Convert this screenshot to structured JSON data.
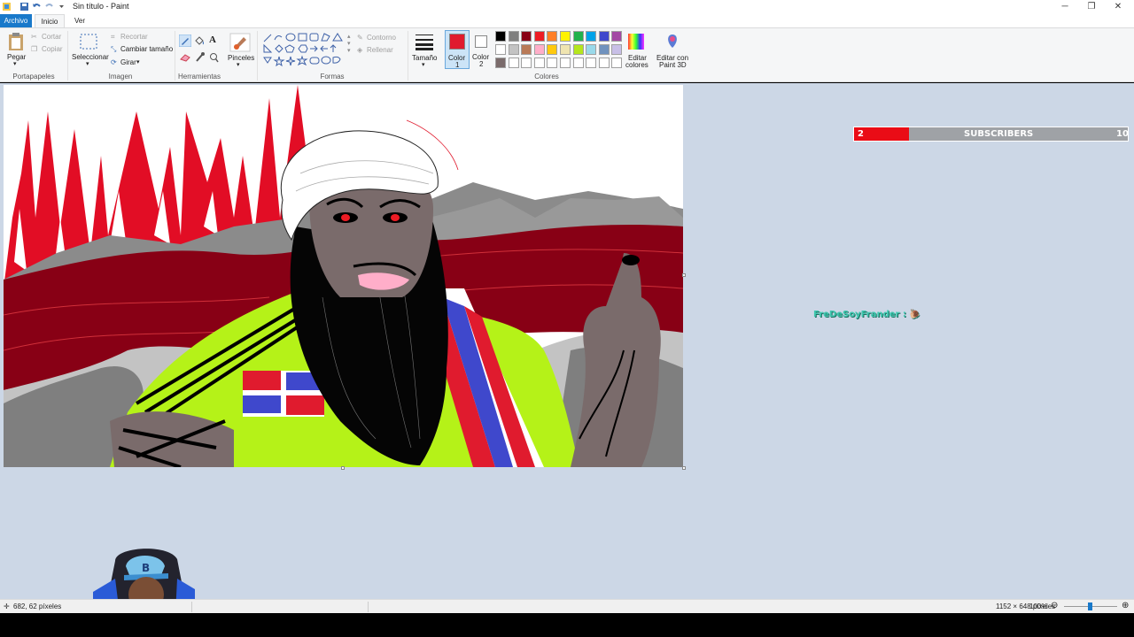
{
  "window": {
    "title": "Sin título - Paint",
    "controls": [
      "minimize",
      "restore",
      "close"
    ]
  },
  "menu": {
    "file_tab": "Archivo",
    "tabs": [
      "Inicio",
      "Ver"
    ]
  },
  "ribbon": {
    "clipboard": {
      "paste": "Pegar",
      "cut": "Cortar",
      "copy": "Copiar",
      "label": "Portapapeles"
    },
    "image": {
      "select": "Seleccionar",
      "crop": "Recortar",
      "resize": "Cambiar tamaño",
      "rotate": "Girar",
      "label": "Imagen"
    },
    "tools": {
      "label": "Herramientas"
    },
    "brushes": {
      "label": "Pinceles"
    },
    "shapes": {
      "outline": "Contorno",
      "fill": "Rellenar",
      "label": "Formas"
    },
    "size": {
      "label": "Tamaño"
    },
    "colors": {
      "color1_line1": "Color",
      "color1_line2": "1",
      "color2_line1": "Color",
      "color2_line2": "2",
      "edit_line1": "Editar",
      "edit_line2": "colores",
      "paint3d_line1": "Editar con",
      "paint3d_line2": "Paint 3D",
      "label": "Colores",
      "color1_value": "#e01b2e",
      "color2_value": "#ffffff",
      "palette_row1": [
        "#000000",
        "#7f7f7f",
        "#880015",
        "#ed1c24",
        "#ff7f27",
        "#fff200",
        "#22b14c",
        "#00a2e8",
        "#3f48cc",
        "#a349a4"
      ],
      "palette_row2": [
        "#ffffff",
        "#c3c3c3",
        "#b97a57",
        "#ffaec9",
        "#ffc90e",
        "#efe4b0",
        "#b5e61d",
        "#99d9ea",
        "#7092be",
        "#c8bfe7"
      ],
      "palette_row3": [
        "#7a6b6b",
        "#ffffff",
        "#ffffff",
        "#ffffff",
        "#ffffff",
        "#ffffff",
        "#ffffff",
        "#ffffff",
        "#ffffff",
        "#ffffff"
      ]
    }
  },
  "overlay": {
    "subscriber_current": "2",
    "subscriber_label": "SUBSCRIBERS",
    "subscriber_goal": "10",
    "subscriber_progress": 0.2,
    "chat_user": "FreDeSoyFrander :"
  },
  "status": {
    "cursor_pos": "682, 62 píxeles",
    "canvas_size": "1152 × 648 píxeles",
    "zoom": "100%"
  }
}
